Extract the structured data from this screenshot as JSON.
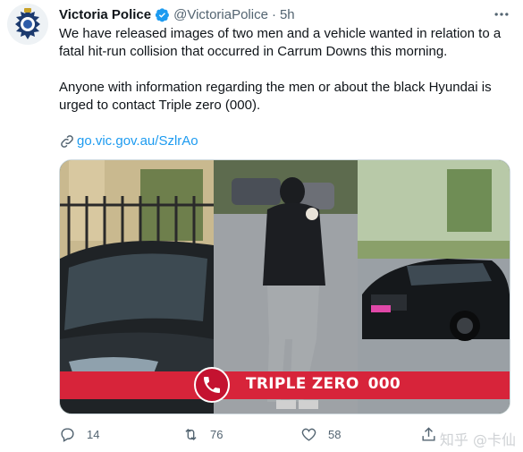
{
  "tweet": {
    "display_name": "Victoria Police",
    "handle": "@VictoriaPolice",
    "separator": "·",
    "time": "5h",
    "paragraph1": "We have released images of two men and a vehicle wanted in relation to a fatal hit-run collision that occurred in Carrum Downs this morning.",
    "paragraph2": "Anyone with information regarding the men or about the black Hyundai is urged to contact Triple zero (000).",
    "link": "go.vic.gov.au/SzlrAo"
  },
  "media": {
    "banner_text": "TRIPLE ZERO",
    "banner_number": "000",
    "banner_color": "#d7243a"
  },
  "actions": {
    "replies": "14",
    "retweets": "76",
    "likes": "58"
  },
  "watermark": "知乎 @卡仙",
  "icons": [
    "police-badge-icon",
    "verified-icon",
    "more-icon",
    "link-icon",
    "phone-icon",
    "reply-icon",
    "retweet-icon",
    "like-icon",
    "share-icon"
  ],
  "colors": {
    "link": "#1d9bf0",
    "secondary": "#536471",
    "verified": "#1d9bf0"
  }
}
